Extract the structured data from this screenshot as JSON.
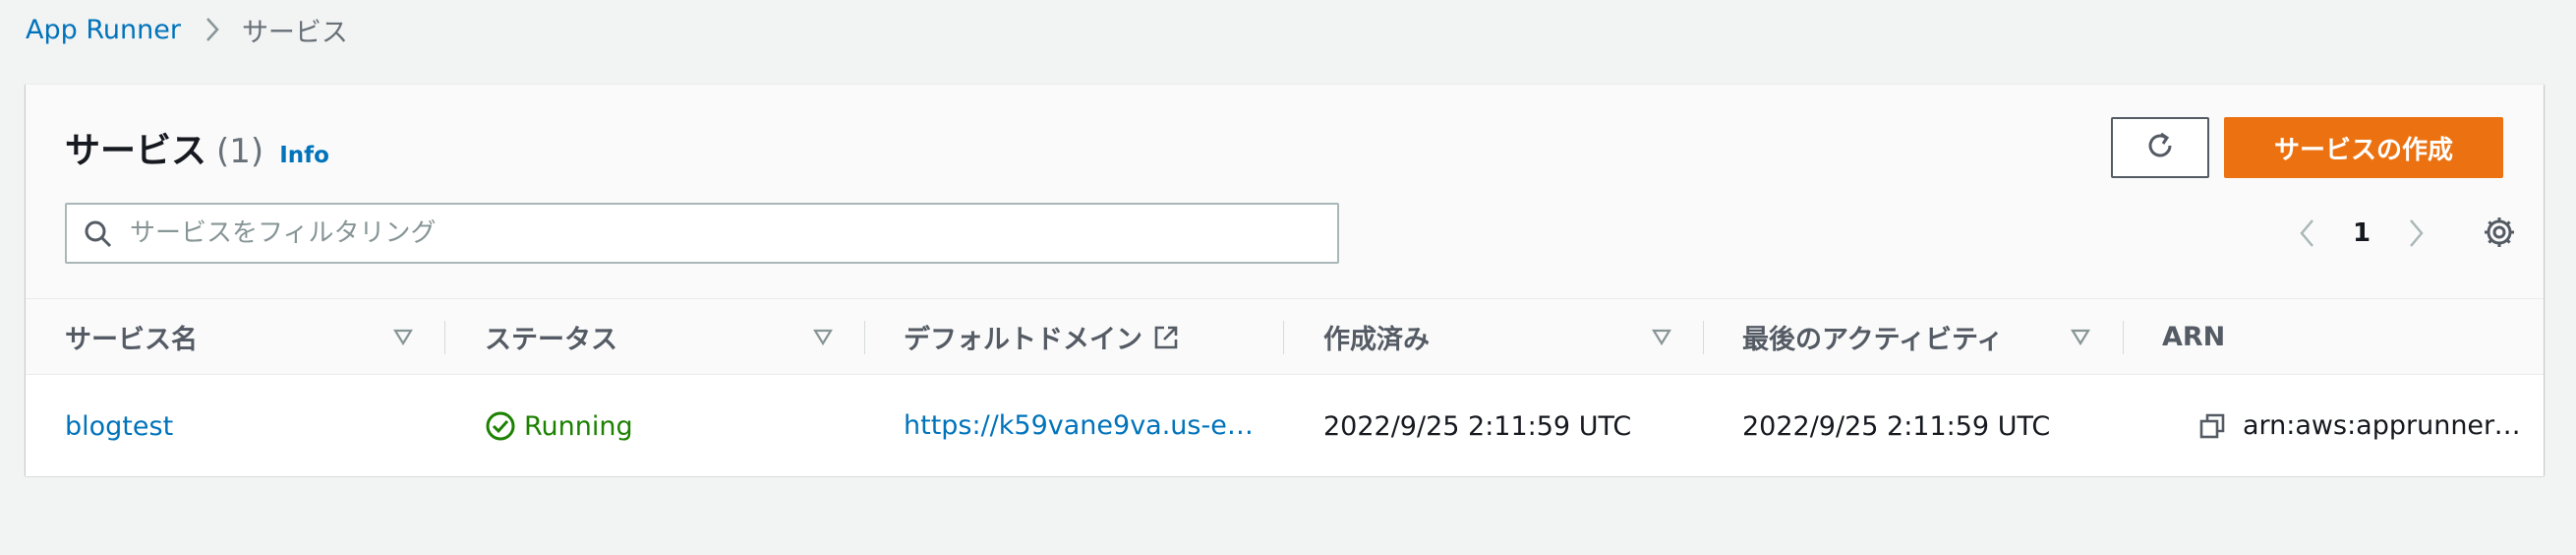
{
  "breadcrumb": {
    "root": "App Runner",
    "current": "サービス"
  },
  "header": {
    "title": "サービス",
    "count": "(1)",
    "info": "Info",
    "create_button": "サービスの作成"
  },
  "search": {
    "placeholder": "サービスをフィルタリング",
    "value": ""
  },
  "pagination": {
    "current_page": "1"
  },
  "table": {
    "columns": [
      {
        "label": "サービス名",
        "sortable": true
      },
      {
        "label": "ステータス",
        "sortable": true
      },
      {
        "label": "デフォルトドメイン",
        "sortable": false,
        "external": true
      },
      {
        "label": "作成済み",
        "sortable": true
      },
      {
        "label": "最後のアクティビティ",
        "sortable": true
      },
      {
        "label": "ARN",
        "sortable": false
      }
    ],
    "rows": [
      {
        "service_name": "blogtest",
        "status": "Running",
        "domain": "https://k59vane9va.us-e…",
        "created": "2022/9/25 2:11:59 UTC",
        "last_activity": "2022/9/25 2:11:59 UTC",
        "arn": "arn:aws:apprunner:u…"
      }
    ]
  },
  "icons": {
    "breadcrumb_separator": "chevron-right-icon",
    "refresh": "refresh-icon",
    "search": "search-icon",
    "prev_page": "chevron-left-icon",
    "next_page": "chevron-right-icon",
    "settings": "gear-icon",
    "sort": "sort-triangle-icon",
    "external": "external-link-icon",
    "status": "status-success-icon",
    "copy": "copy-icon"
  },
  "colors": {
    "link": "#0073bb",
    "primary_button": "#ec7211",
    "success": "#1d8102",
    "page_background": "#f2f3f3"
  }
}
